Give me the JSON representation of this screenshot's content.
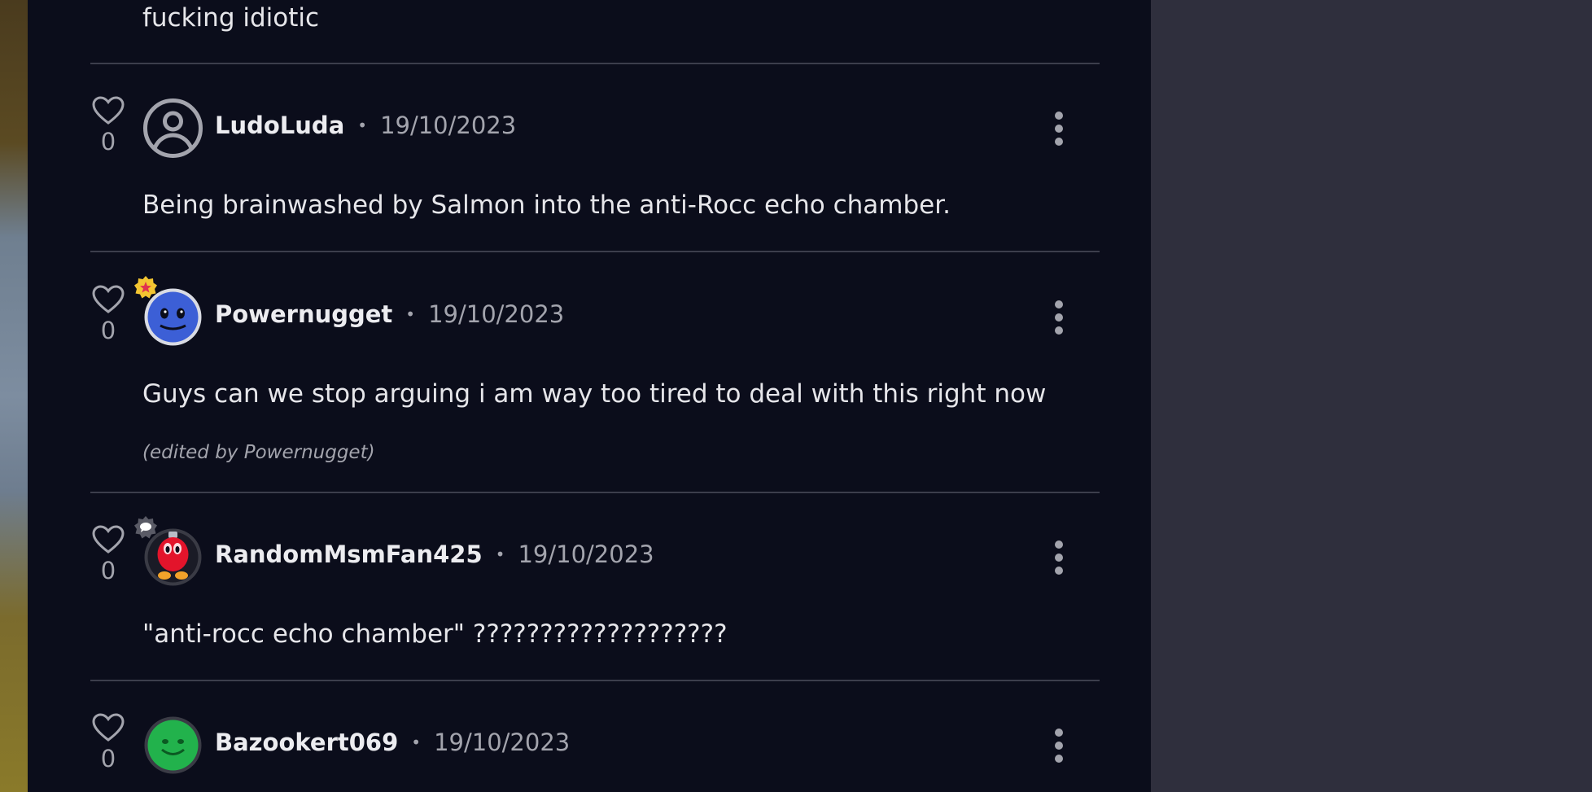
{
  "previous_comment": {
    "text_tail": "fucking idiotic"
  },
  "comments": [
    {
      "username": "LudoLuda",
      "date": "19/10/2023",
      "likes": "0",
      "text": "Being brainwashed by Salmon into the anti-Rocc echo chamber.",
      "avatar_icon": "default-user-icon",
      "edited_note": null
    },
    {
      "username": "Powernugget",
      "date": "19/10/2023",
      "likes": "0",
      "text": "Guys can we stop arguing i am way too tired to deal with this right now",
      "avatar_icon": "blue-face-avatar",
      "badge_icon": "star-badge-icon",
      "edited_note": "(edited by Powernugget)"
    },
    {
      "username": "RandomMsmFan425",
      "date": "19/10/2023",
      "likes": "0",
      "text": "\"anti-rocc echo chamber\" ???????????????????",
      "avatar_icon": "red-bomb-avatar",
      "badge_icon": "chat-badge-icon",
      "edited_note": null
    },
    {
      "username": "Bazookert069",
      "date": "19/10/2023",
      "likes": "0",
      "text": "",
      "avatar_icon": "green-face-avatar",
      "edited_note": null
    }
  ],
  "colors": {
    "feed_bg": "#0b0d1b",
    "page_bg": "#2f2f3d",
    "text": "#e6e6ea",
    "muted": "#a3a4ad",
    "divider": "#3c3e4c"
  }
}
